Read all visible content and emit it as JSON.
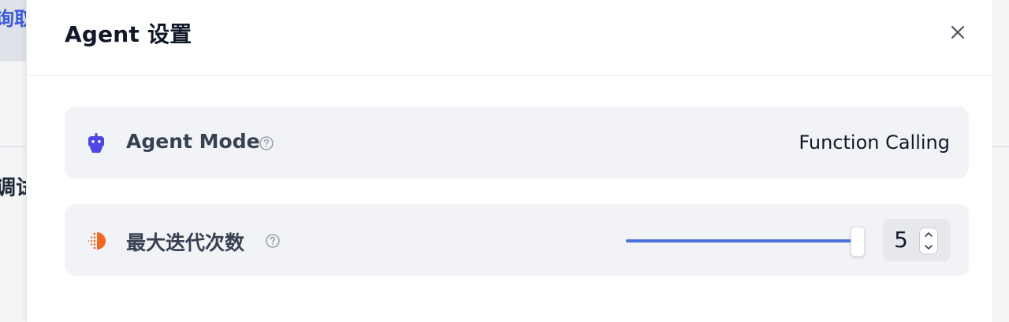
{
  "background": {
    "top_text": "询取",
    "side_text": "调试"
  },
  "modal": {
    "title": "Agent 设置",
    "settings": [
      {
        "label": "Agent Mode",
        "value": "Function Calling",
        "icon": "robot-icon"
      },
      {
        "label": "最大迭代次数",
        "value": "5",
        "icon": "iteration-icon",
        "slider_fraction": 1.0
      }
    ]
  },
  "colors": {
    "accent": "#4a6fe0",
    "robot_icon": "#4f46e5",
    "iteration_icon": "#f26522"
  }
}
